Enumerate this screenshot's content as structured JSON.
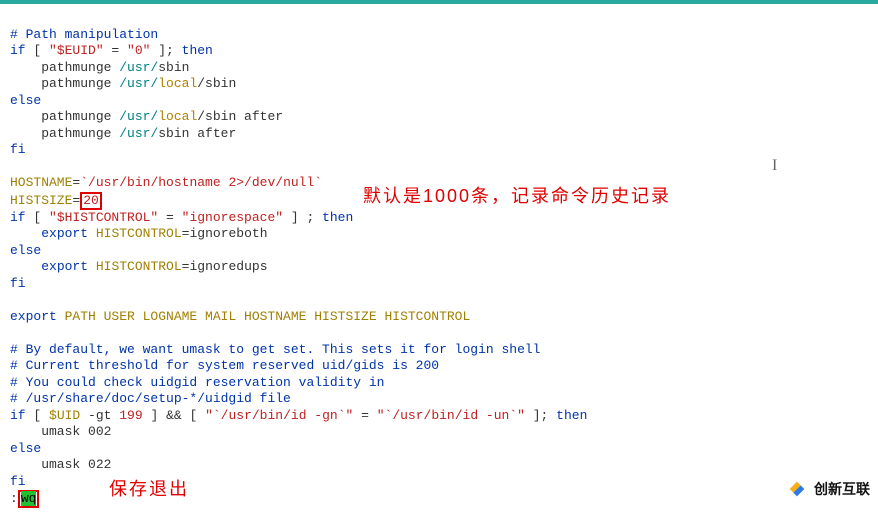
{
  "lines": {
    "l1": "# Path manipulation",
    "l2_if": "if",
    "l2_b1": " [ ",
    "l2_s1": "\"$EUID\"",
    "l2_eq": " = ",
    "l2_s2": "\"0\"",
    "l2_b2": " ]; ",
    "l2_then": "then",
    "l3_pre": "    pathmunge ",
    "l3_path1": "/usr/",
    "l3_sbin": "sbin",
    "l4_pre": "    pathmunge ",
    "l4_path1": "/usr/",
    "l4_local": "local",
    "l4_sbin": "/sbin",
    "l5_else": "else",
    "l6_pre": "    pathmunge ",
    "l6_path1": "/usr/",
    "l6_local": "local",
    "l6_rest": "/sbin after",
    "l7_pre": "    pathmunge ",
    "l7_path1": "/usr/",
    "l7_rest": "sbin after",
    "l8_fi": "fi",
    "l10_hn": "HOSTNAME",
    "l10_eq": "=",
    "l10_s": "`/usr/bin/hostname 2>/dev/null`",
    "l11_hs": "HISTSIZE",
    "l11_eq": "=",
    "l11_v": "20",
    "l12_if": "if",
    "l12_b1": " [ ",
    "l12_s1": "\"$HISTCONTROL\"",
    "l12_eq": " = ",
    "l12_s2": "\"ignorespace\"",
    "l12_b2": " ] ; ",
    "l12_then": "then",
    "l13_pre": "    ",
    "l13_exp": "export",
    "l13_sp": " ",
    "l13_hc": "HISTCONTROL",
    "l13_eq": "=",
    "l13_v": "ignoreboth",
    "l14_else": "else",
    "l15_pre": "    ",
    "l15_exp": "export",
    "l15_sp": " ",
    "l15_hc": "HISTCONTROL",
    "l15_eq": "=",
    "l15_v": "ignoredups",
    "l16_fi": "fi",
    "l18_exp": "export",
    "l18_vars": " PATH USER LOGNAME MAIL HOSTNAME HISTSIZE HISTCONTROL",
    "l20": "# By default, we want umask to get set. This sets it for login shell",
    "l21": "# Current threshold for system reserved uid/gids is 200",
    "l22": "# You could check uidgid reservation validity in",
    "l23": "# /usr/share/doc/setup-*/uidgid file",
    "l24_if": "if",
    "l24_b1": " [ ",
    "l24_uid": "$UID",
    "l24_gt": " -gt ",
    "l24_n": "199",
    "l24_b2": " ] ",
    "l24_and": "&&",
    "l24_b3": " [ ",
    "l24_s1": "\"`/usr/bin/id -gn`\"",
    "l24_eq": " = ",
    "l24_s2": "\"`/usr/bin/id -un`\"",
    "l24_b4": " ]; ",
    "l24_then": "then",
    "l25": "    umask 002",
    "l26_else": "else",
    "l27": "    umask 022",
    "l28_fi": "fi",
    "l29_colon": ":",
    "l29_wq": "wq"
  },
  "annotations": {
    "hist_note": "默认是1000条，记录命令历史记录",
    "save_note": "保存退出"
  },
  "watermark": {
    "text": "创新互联"
  },
  "cursor": "I"
}
